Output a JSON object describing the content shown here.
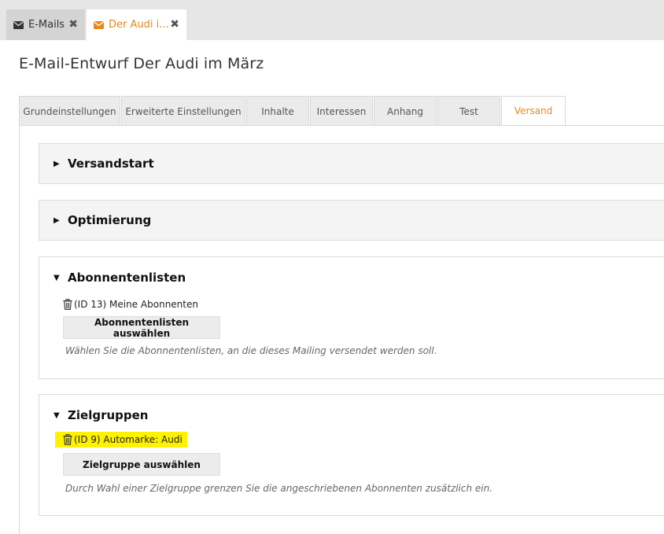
{
  "doc_tabs": [
    {
      "label": "E-Mails",
      "icon": "envelope-icon",
      "active": false
    },
    {
      "label": "Der Audi i...",
      "icon": "envelope-icon",
      "active": true
    }
  ],
  "close_symbol": "✖",
  "page_title": "E-Mail-Entwurf Der Audi im März",
  "settings_tabs": [
    "Grundeinstellungen",
    "Erweiterte Einstellungen",
    "Inhalte",
    "Interessen",
    "Anhang",
    "Test",
    "Versand"
  ],
  "active_settings_tab": "Versand",
  "panels": {
    "versandstart": {
      "title": "Versandstart",
      "expanded": false
    },
    "optimierung": {
      "title": "Optimierung",
      "expanded": false
    },
    "abonnentenlisten": {
      "title": "Abonnentenlisten",
      "expanded": true,
      "item": "(ID 13) Meine Abonnenten",
      "button": "Abonnentenlisten auswählen",
      "hint": "Wählen Sie die Abonnentenlisten, an die dieses Mailing versendet werden soll."
    },
    "zielgruppen": {
      "title": "Zielgruppen",
      "expanded": true,
      "item": "(ID 9) Automarke: Audi",
      "button": "Zielgruppe auswählen",
      "hint": "Durch Wahl einer Zielgruppe grenzen Sie die angeschriebenen Abonnenten zusätzlich ein."
    }
  },
  "colors": {
    "accent": "#e8871e",
    "highlight": "#fff200"
  }
}
